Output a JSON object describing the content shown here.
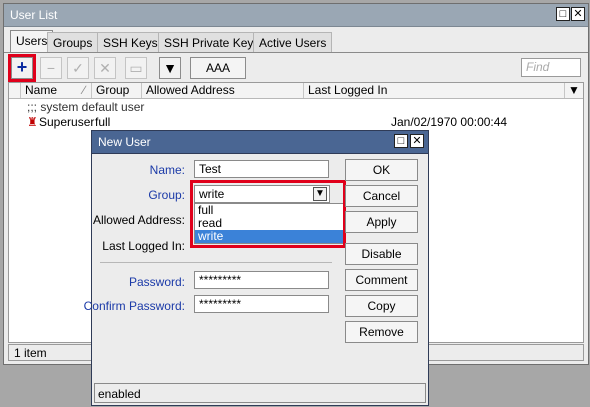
{
  "main_window": {
    "title": "User List",
    "tabs": [
      {
        "label": "Users"
      },
      {
        "label": "Groups"
      },
      {
        "label": "SSH Keys"
      },
      {
        "label": "SSH Private Keys"
      },
      {
        "label": "Active Users"
      }
    ],
    "toolbar": {
      "add_icon": "plus-icon",
      "aaa_label": "AAA",
      "find_placeholder": "Find"
    },
    "table": {
      "columns": [
        "Name",
        "Group",
        "Allowed Address",
        "Last Logged In"
      ],
      "comment_row": ";;; system default user",
      "rows": [
        {
          "name": "Superuser",
          "group": "full",
          "allowed_address": "",
          "last_logged_in": "Jan/02/1970 00:00:44"
        }
      ]
    },
    "status": "1 item"
  },
  "dialog": {
    "title": "New User",
    "name_label": "Name:",
    "name_value": "Test",
    "group_label": "Group:",
    "group_value": "write",
    "group_options": [
      "full",
      "read",
      "write"
    ],
    "allowed_address_label": "Allowed Address:",
    "last_logged_in_label": "Last Logged In:",
    "password_label": "Password:",
    "password_value": "*********",
    "confirm_password_label": "Confirm Password:",
    "confirm_password_value": "*********",
    "buttons": {
      "ok": "OK",
      "cancel": "Cancel",
      "apply": "Apply",
      "disable": "Disable",
      "comment": "Comment",
      "copy": "Copy",
      "remove": "Remove"
    },
    "status": "enabled"
  },
  "colors": {
    "highlight_box": "#e0001b",
    "dialog_title": "#4a6693",
    "selected_option": "#3b82d8",
    "field_labels": "#1b3aa8"
  }
}
